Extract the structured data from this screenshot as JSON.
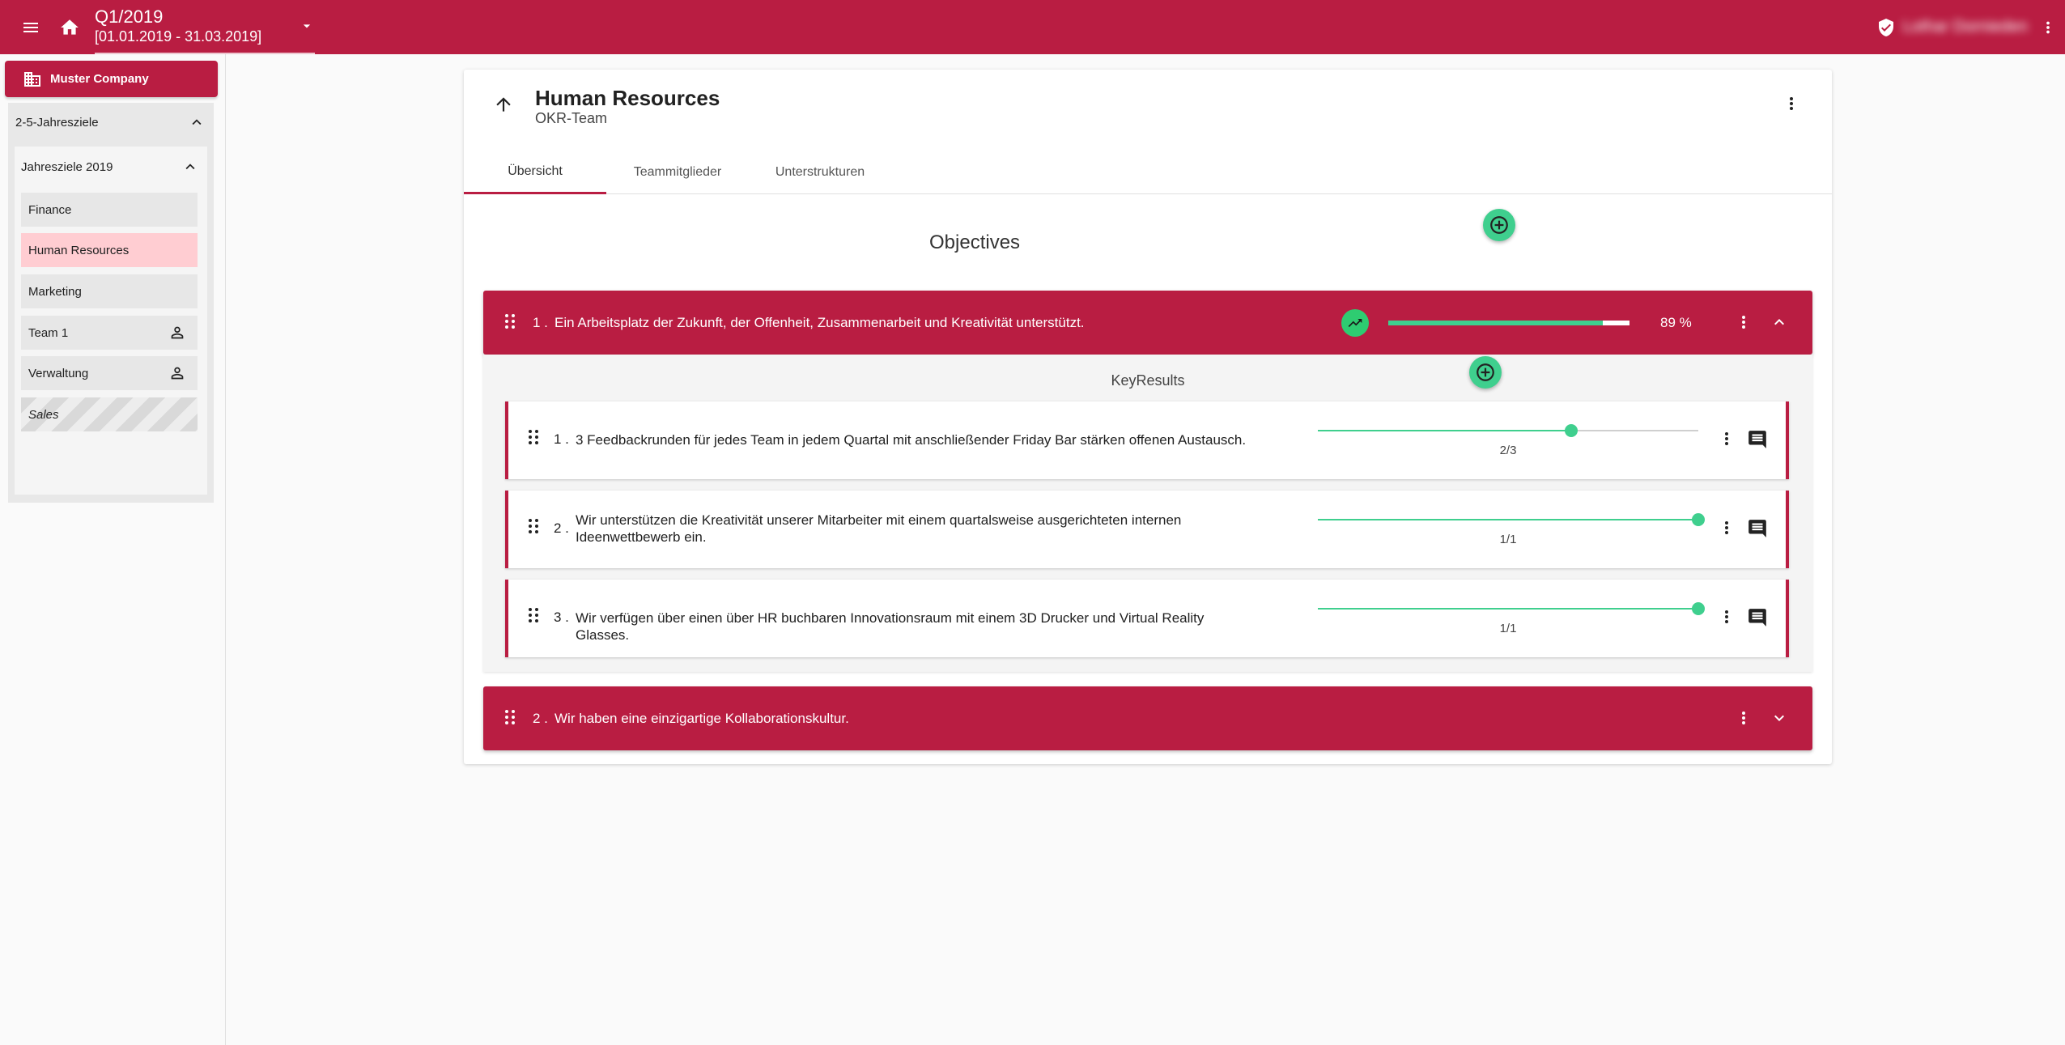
{
  "topbar": {
    "period_title": "Q1/2019",
    "period_range": "[01.01.2019 - 31.03.2019]",
    "user_name": "Lothar Dornieden"
  },
  "sidebar": {
    "company": "Muster Company",
    "long_term_goals": "2-5-Jahresziele",
    "year_goals": "Jahresziele 2019",
    "units": [
      {
        "label": "Finance",
        "state": "normal"
      },
      {
        "label": "Human Resources",
        "state": "active"
      },
      {
        "label": "Marketing",
        "state": "normal"
      },
      {
        "label": "Team 1",
        "state": "team"
      },
      {
        "label": "Verwaltung",
        "state": "team"
      },
      {
        "label": "Sales",
        "state": "inactive"
      }
    ]
  },
  "card": {
    "title": "Human Resources",
    "subtitle": "OKR-Team",
    "tabs": [
      "Übersicht",
      "Teammitglieder",
      "Unterstrukturen"
    ],
    "active_tab": "Übersicht"
  },
  "objectives_title": "Objectives",
  "objectives": [
    {
      "number": "1 .",
      "text": "Ein Arbeitsplatz der Zukunft, der Offenheit, Zusammenarbeit und Kreativität unterstützt.",
      "progress_percent": 89,
      "progress_label": "89 %",
      "expanded": true,
      "keyresults_label": "KeyResults",
      "keyresults": [
        {
          "number": "1 .",
          "text": "3 Feedbackrunden für jedes Team in jedem Quartal mit anschließender Friday Bar stärken offenen Austausch.",
          "current": 2,
          "target": 3,
          "value_label": "2/3"
        },
        {
          "number": "2 .",
          "text": "Wir unterstützen die Kreativität unserer Mitarbeiter mit einem quartalsweise ausgerichteten internen Ideenwettbewerb ein.",
          "current": 1,
          "target": 1,
          "value_label": "1/1"
        },
        {
          "number": "3 .",
          "text": "Wir verfügen über einen über HR buchbaren Innovationsraum mit einem 3D Drucker und Virtual Reality Glasses.",
          "current": 1,
          "target": 1,
          "value_label": "1/1"
        }
      ]
    },
    {
      "number": "2 .",
      "text": "Wir haben eine einzigartige Kollaborationskultur.",
      "expanded": false
    }
  ],
  "colors": {
    "brand": "#b91d42",
    "accent": "#3fcf8e",
    "active_unit": "#ffcdd2"
  },
  "icons": [
    "menu-icon",
    "home-icon",
    "caret-down-icon",
    "shield-check-icon",
    "more-vert-icon",
    "domain-icon",
    "chevron-up-icon",
    "chevron-down-icon",
    "person-icon",
    "arrow-up-icon",
    "add-circle-icon",
    "drag-handle-icon",
    "trending-up-icon",
    "comment-icon"
  ]
}
